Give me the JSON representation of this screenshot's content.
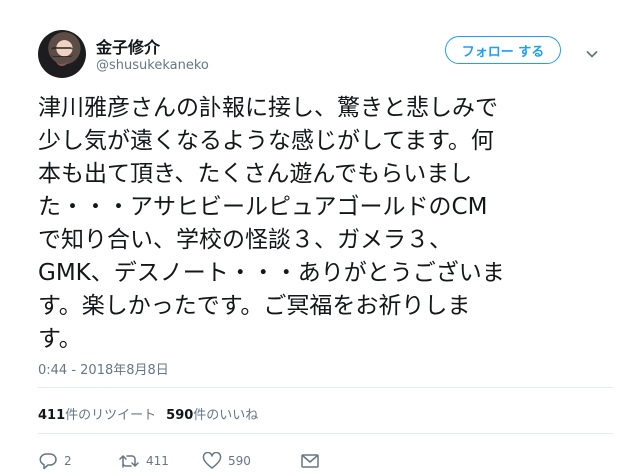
{
  "author": {
    "name": "金子修介",
    "handle": "@shusukekaneko"
  },
  "follow_button": {
    "label": "フォロー する"
  },
  "tweet": {
    "lines": [
      "津川雅彦さんの訃報に接し、驚きと悲しみで",
      "少し気が遠くなるような感じがしてます。何",
      "本も出て頂き、たくさん遊んでもらいまし",
      "た・・・アサヒビールピュアゴールドのCM",
      "で知り合い、学校の怪談３、ガメラ３、",
      "GMK、デスノート・・・ありがとうございま",
      "す。楽しかったです。ご冥福をお祈りしま",
      "す。"
    ],
    "timestamp": "0:44 - 2018年8月8日"
  },
  "stats": {
    "retweets_count": "411",
    "retweets_label": "件のリツイート",
    "likes_count": "590",
    "likes_label": "件のいいね"
  },
  "actions": {
    "reply_count": "2",
    "retweet_count": "411",
    "like_count": "590"
  },
  "colors": {
    "accent": "#1da1f2",
    "secondary_text": "#657786",
    "divider": "#e6ecf0"
  },
  "icons": [
    "avatar",
    "chevron-down-icon",
    "reply-icon",
    "retweet-icon",
    "heart-icon",
    "message-icon"
  ]
}
